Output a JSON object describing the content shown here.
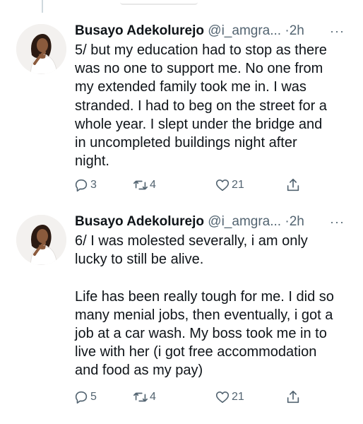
{
  "tweets": [
    {
      "author_name": "Busayo Adekolurejo",
      "handle": "@i_amgra...",
      "separator": "·",
      "time": "2h",
      "more": "···",
      "text": "5/ but my education had to stop as there\nwas no one to support me. No one from\nmy extended family took me in. I was\nstranded. I had to beg on the street for a\nwhole year. I slept under the bridge and\nin uncompleted buildings night after\nnight.",
      "replies": "3",
      "retweets": "4",
      "likes": "21",
      "icons": [
        "reply-icon",
        "retweet-icon",
        "like-icon",
        "share-icon"
      ]
    },
    {
      "author_name": "Busayo Adekolurejo",
      "handle": "@i_amgra...",
      "separator": "·",
      "time": "2h",
      "more": "···",
      "text": "6/ I was molested severally, i am only\nlucky to still be alive.\n\nLife has been really tough for me. I did so\nmany menial jobs, then eventually, i got a\njob at a car wash. My boss took me in to\nlive with her (i got free accommodation\nand food as my pay)",
      "replies": "5",
      "retweets": "4",
      "likes": "21",
      "icons": [
        "reply-icon",
        "retweet-icon",
        "like-icon",
        "share-icon"
      ]
    }
  ],
  "colors": {
    "text": "#0f1419",
    "secondary": "#536471",
    "thread_line": "#cfd9de"
  }
}
